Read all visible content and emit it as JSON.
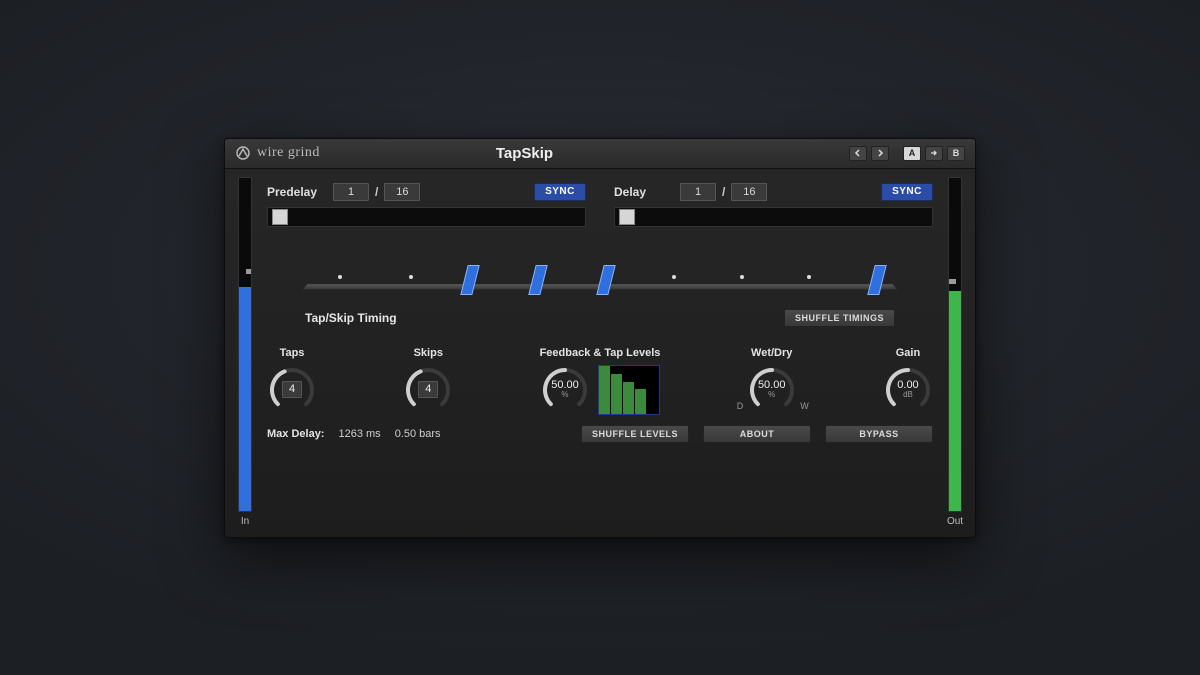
{
  "brand": "wire grind",
  "title": "TapSkip",
  "nav": {
    "a": "A",
    "b": "B"
  },
  "predelay": {
    "label": "Predelay",
    "num": "1",
    "den": "16",
    "sync": "SYNC",
    "slider_pos": 0.03
  },
  "delay": {
    "label": "Delay",
    "num": "1",
    "den": "16",
    "sync": "SYNC",
    "slider_pos": 0.03
  },
  "timing": {
    "label": "Tap/Skip Timing",
    "shuffle_btn": "SHUFFLE TIMINGS",
    "marks": [
      {
        "type": "skip",
        "pos": 0.06
      },
      {
        "type": "skip",
        "pos": 0.18
      },
      {
        "type": "tap",
        "pos": 0.28
      },
      {
        "type": "tap",
        "pos": 0.395
      },
      {
        "type": "tap",
        "pos": 0.51
      },
      {
        "type": "skip",
        "pos": 0.625
      },
      {
        "type": "skip",
        "pos": 0.74
      },
      {
        "type": "skip",
        "pos": 0.855
      },
      {
        "type": "tap",
        "pos": 0.97
      }
    ]
  },
  "knobs": {
    "taps": {
      "label": "Taps",
      "value": "4",
      "arc": 0.42
    },
    "skips": {
      "label": "Skips",
      "value": "4",
      "arc": 0.42
    },
    "feedback": {
      "label": "Feedback & Tap Levels",
      "value": "50.00",
      "unit": "%",
      "arc": 0.5,
      "tap_levels": [
        1.0,
        0.82,
        0.66,
        0.52
      ]
    },
    "wetdry": {
      "label": "Wet/Dry",
      "value": "50.00",
      "unit": "%",
      "arc": 0.5,
      "d": "D",
      "w": "W"
    },
    "gain": {
      "label": "Gain",
      "value": "0.00",
      "unit": "dB",
      "arc": 0.5
    }
  },
  "bottom": {
    "maxdelay_label": "Max Delay:",
    "maxdelay_ms": "1263 ms",
    "maxdelay_bars": "0.50 bars",
    "shuffle_levels": "SHUFFLE LEVELS",
    "about": "ABOUT",
    "bypass": "BYPASS"
  },
  "meters": {
    "in_label": "In",
    "out_label": "Out"
  }
}
